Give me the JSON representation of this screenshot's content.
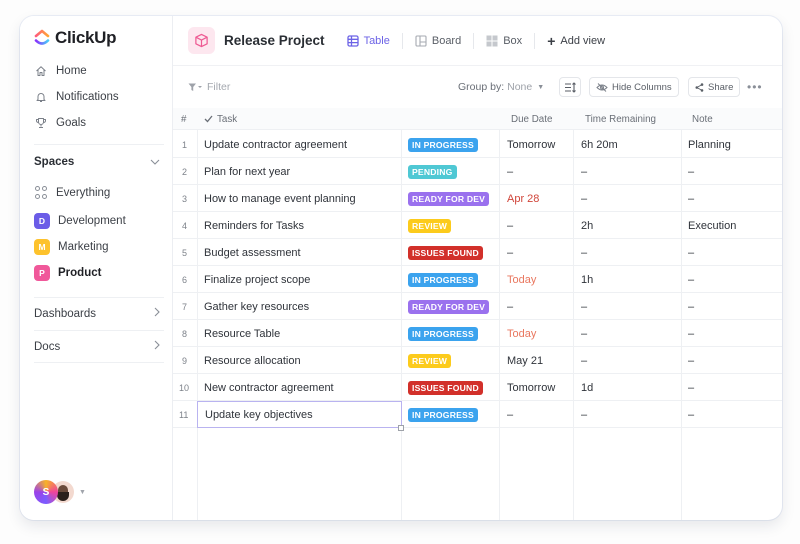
{
  "app": {
    "name": "ClickUp"
  },
  "sidebar": {
    "nav": [
      {
        "label": "Home",
        "icon": "home-icon"
      },
      {
        "label": "Notifications",
        "icon": "bell-icon"
      },
      {
        "label": "Goals",
        "icon": "trophy-icon"
      }
    ],
    "spaces_label": "Spaces",
    "spaces": [
      {
        "label": "Everything",
        "badge": "",
        "color": ""
      },
      {
        "label": "Development",
        "badge": "D",
        "color": "#6b5ce7"
      },
      {
        "label": "Marketing",
        "badge": "M",
        "color": "#fdc22c"
      },
      {
        "label": "Product",
        "badge": "P",
        "color": "#f0589a"
      }
    ],
    "dashboards_label": "Dashboards",
    "docs_label": "Docs",
    "user_initial": "S"
  },
  "header": {
    "project_title": "Release Project",
    "views": [
      {
        "label": "Table",
        "active": true
      },
      {
        "label": "Board",
        "active": false
      },
      {
        "label": "Box",
        "active": false
      }
    ],
    "add_view_label": "Add view"
  },
  "toolbar": {
    "filter_label": "Filter",
    "group_by_label": "Group by:",
    "group_by_value": "None",
    "hide_columns_label": "Hide Columns",
    "share_label": "Share"
  },
  "table": {
    "headers": {
      "num": "#",
      "task": "Task",
      "due": "Due Date",
      "time": "Time Remaining",
      "note": "Note"
    },
    "status_colors": {
      "IN PROGRESS": "#3ba3ee",
      "PENDING": "#4fc8d4",
      "READY FOR DEV": "#9a71ee",
      "REVIEW": "#fccb1c",
      "ISSUES FOUND": "#d2302a"
    },
    "overdue_color": "#d0453a",
    "today_color": "#e9775f",
    "rows": [
      {
        "num": "1",
        "task": "Update contractor agreement",
        "status": "IN PROGRESS",
        "due": "Tomorrow",
        "due_style": "normal",
        "time": "6h 20m",
        "note": "Planning"
      },
      {
        "num": "2",
        "task": "Plan for next year",
        "status": "PENDING",
        "due": "–",
        "due_style": "dash",
        "time": "–",
        "note": "–"
      },
      {
        "num": "3",
        "task": "How to manage event planning",
        "status": "READY FOR DEV",
        "due": "Apr 28",
        "due_style": "overdue",
        "time": "–",
        "note": "–"
      },
      {
        "num": "4",
        "task": "Reminders for Tasks",
        "status": "REVIEW",
        "due": "–",
        "due_style": "dash",
        "time": "2h",
        "note": "Execution"
      },
      {
        "num": "5",
        "task": "Budget assessment",
        "status": "ISSUES FOUND",
        "due": "–",
        "due_style": "dash",
        "time": "–",
        "note": "–"
      },
      {
        "num": "6",
        "task": "Finalize project scope",
        "status": "IN PROGRESS",
        "due": "Today",
        "due_style": "today",
        "time": "1h",
        "note": "–"
      },
      {
        "num": "7",
        "task": "Gather key resources",
        "status": "READY FOR DEV",
        "due": "–",
        "due_style": "dash",
        "time": "–",
        "note": "–"
      },
      {
        "num": "8",
        "task": "Resource Table",
        "status": "IN PROGRESS",
        "due": "Today",
        "due_style": "today",
        "time": "–",
        "note": "–"
      },
      {
        "num": "9",
        "task": "Resource allocation",
        "status": "REVIEW",
        "due": "May 21",
        "due_style": "normal",
        "time": "–",
        "note": "–"
      },
      {
        "num": "10",
        "task": "New contractor agreement",
        "status": "ISSUES FOUND",
        "due": "Tomorrow",
        "due_style": "normal",
        "time": "1d",
        "note": "–"
      },
      {
        "num": "11",
        "task": "Update key objectives",
        "status": "IN PROGRESS",
        "due": "–",
        "due_style": "dash",
        "time": "–",
        "note": "–",
        "selected": true
      }
    ]
  }
}
